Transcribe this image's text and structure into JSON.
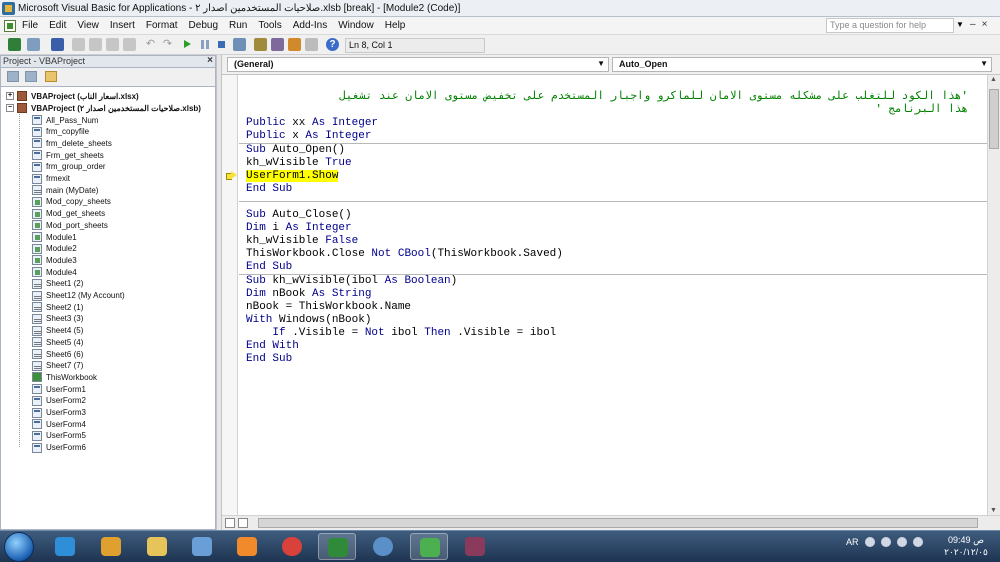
{
  "window": {
    "title": "Microsoft Visual Basic for Applications - صلاحيات المستخدمين اصدار ٢.xlsb [break] - [Module2 (Code)]"
  },
  "menu": {
    "items": [
      "File",
      "Edit",
      "View",
      "Insert",
      "Format",
      "Debug",
      "Run",
      "Tools",
      "Add-Ins",
      "Window",
      "Help"
    ],
    "question_placeholder": "Type a question for help"
  },
  "toolbar": {
    "position": "Ln 8, Col 1"
  },
  "project_explorer": {
    "title": "Project - VBAProject",
    "projects": [
      "VBAProject (اسعار الناب.xlsx)",
      "VBAProject (صلاحيات المستخدمين اصدار ٢.xlsb)"
    ],
    "items": [
      {
        "label": "All_Pass_Num",
        "icon": "form-icon"
      },
      {
        "label": "frm_copyfile",
        "icon": "form-icon"
      },
      {
        "label": "frm_delete_sheets",
        "icon": "form-icon"
      },
      {
        "label": "Frm_get_sheets",
        "icon": "form-icon"
      },
      {
        "label": "frm_group_order",
        "icon": "form-icon"
      },
      {
        "label": "frmexit",
        "icon": "form-icon"
      },
      {
        "label": "main (MyDate)",
        "icon": "sheet-icon"
      },
      {
        "label": "Mod_copy_sheets",
        "icon": "module-icon"
      },
      {
        "label": "Mod_get_sheets",
        "icon": "module-icon"
      },
      {
        "label": "Mod_port_sheets",
        "icon": "module-icon"
      },
      {
        "label": "Module1",
        "icon": "module-icon"
      },
      {
        "label": "Module2",
        "icon": "module-icon"
      },
      {
        "label": "Module3",
        "icon": "module-icon"
      },
      {
        "label": "Module4",
        "icon": "module-icon"
      },
      {
        "label": "Sheet1 (2)",
        "icon": "sheet-icon"
      },
      {
        "label": "Sheet12 (My Account)",
        "icon": "sheet-icon"
      },
      {
        "label": "Sheet2 (1)",
        "icon": "sheet-icon"
      },
      {
        "label": "Sheet3 (3)",
        "icon": "sheet-icon"
      },
      {
        "label": "Sheet4 (5)",
        "icon": "sheet-icon"
      },
      {
        "label": "Sheet5 (4)",
        "icon": "sheet-icon"
      },
      {
        "label": "Sheet6 (6)",
        "icon": "sheet-icon"
      },
      {
        "label": "Sheet7 (7)",
        "icon": "sheet-icon"
      },
      {
        "label": "ThisWorkbook",
        "icon": "workbook-icon"
      },
      {
        "label": "UserForm1",
        "icon": "form-icon"
      },
      {
        "label": "UserForm2",
        "icon": "form-icon"
      },
      {
        "label": "UserForm3",
        "icon": "form-icon"
      },
      {
        "label": "UserForm4",
        "icon": "form-icon"
      },
      {
        "label": "UserForm5",
        "icon": "form-icon"
      },
      {
        "label": "UserForm6",
        "icon": "form-icon"
      }
    ]
  },
  "code_window": {
    "object_combo": "(General)",
    "procedure_combo": "Auto_Open",
    "comment_line1": "'هذا الكود للتغلب على مشكله مستوى الامان للماكرو واجبار المستخدم على تخفيض مستوى الامان عند تشغيل",
    "comment_line2": "هذا البرنامج '",
    "lines": {
      "l3": {
        "kw1": "Public",
        "t1": " xx ",
        "kw2": "As Integer"
      },
      "l4": {
        "kw1": "Public",
        "t1": " x ",
        "kw2": "As Integer"
      },
      "l5": {
        "kw1": "Sub",
        "t1": " Auto_Open()"
      },
      "l6": {
        "t1": "kh_wVisible ",
        "kw1": "True"
      },
      "l7": {
        "t1": "UserForm1.Show"
      },
      "l8": {
        "kw1": "End Sub"
      },
      "l10": {
        "kw1": "Sub",
        "t1": " Auto_Close()"
      },
      "l11": {
        "kw1": "Dim",
        "t1": " i ",
        "kw2": "As Integer"
      },
      "l12": {
        "t1": "kh_wVisible ",
        "kw1": "False"
      },
      "l13": {
        "t1": "ThisWorkbook.Close ",
        "kw1": "Not",
        "t2": " ",
        "kw2": "CBool",
        "t3": "(ThisWorkbook.Saved)"
      },
      "l14": {
        "kw1": "End Sub"
      },
      "l15": {
        "kw1": "Sub",
        "t1": " kh_wVisible(ibol ",
        "kw2": "As Boolean",
        "t2": ")"
      },
      "l16": {
        "kw1": "Dim",
        "t1": " nBook ",
        "kw2": "As String"
      },
      "l17": {
        "t1": "nBook = ThisWorkbook.Name"
      },
      "l18": {
        "kw1": "With",
        "t1": " Windows(nBook)"
      },
      "l19": {
        "t0": "    ",
        "kw1": "If",
        "t1": " .Visible = ",
        "kw2": "Not",
        "t2": " ibol ",
        "kw3": "Then",
        "t3": " .Visible = ibol"
      },
      "l20": {
        "kw1": "End With"
      },
      "l21": {
        "kw1": "End Sub"
      }
    }
  },
  "taskbar": {
    "lang": "AR",
    "time": "09:49 ص",
    "date": "٢٠٢٠/١٢/٠٥"
  }
}
